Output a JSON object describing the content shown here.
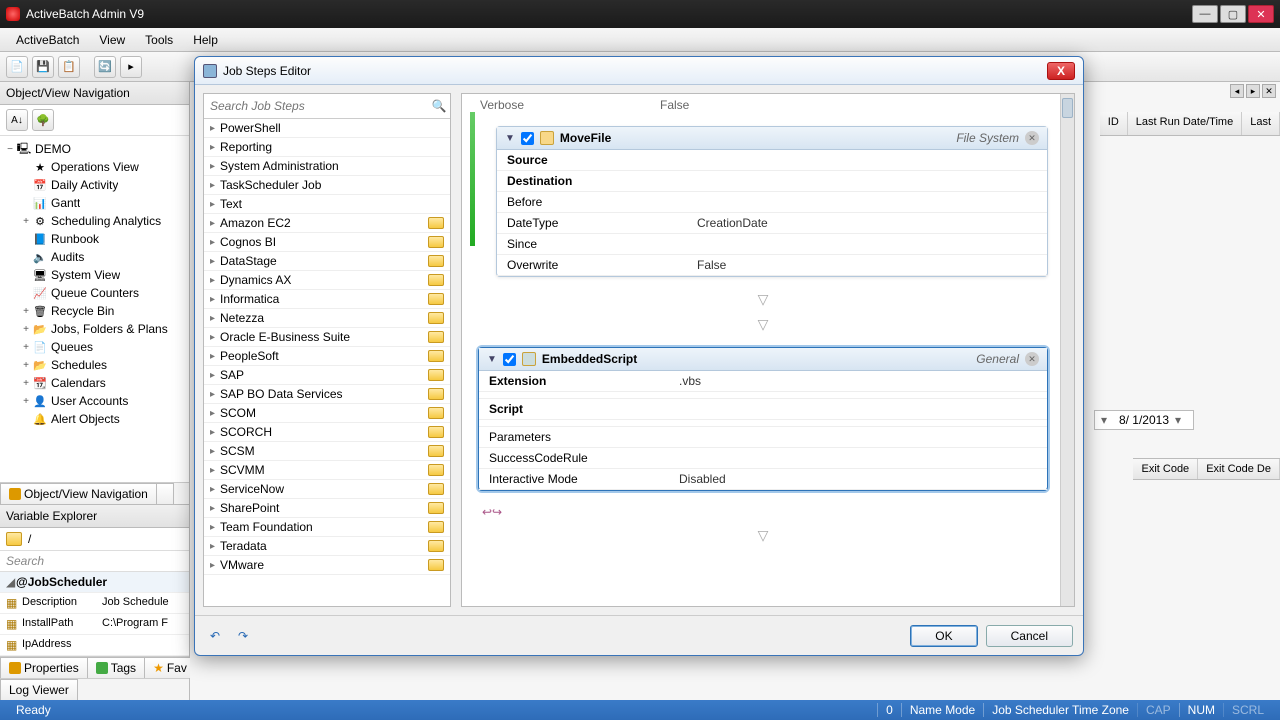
{
  "window": {
    "title": "ActiveBatch Admin V9"
  },
  "menubar": [
    "ActiveBatch",
    "View",
    "Tools",
    "Help"
  ],
  "nav_header": "Object/View Navigation",
  "tree": {
    "root": "DEMO",
    "items": [
      {
        "label": "Operations View",
        "ico": "★"
      },
      {
        "label": "Daily Activity",
        "ico": "📅"
      },
      {
        "label": "Gantt",
        "ico": "📊"
      },
      {
        "label": "Scheduling Analytics",
        "ico": "⚙",
        "exp": "+"
      },
      {
        "label": "Runbook",
        "ico": "📘"
      },
      {
        "label": "Audits",
        "ico": "🔈"
      },
      {
        "label": "System View",
        "ico": "🖥"
      },
      {
        "label": "Queue Counters",
        "ico": "📈"
      },
      {
        "label": "Recycle Bin",
        "ico": "🗑",
        "exp": "+"
      },
      {
        "label": "Jobs, Folders & Plans",
        "ico": "📂",
        "exp": "+"
      },
      {
        "label": "Queues",
        "ico": "📄",
        "exp": "+"
      },
      {
        "label": "Schedules",
        "ico": "📂",
        "exp": "+"
      },
      {
        "label": "Calendars",
        "ico": "📆",
        "exp": "+"
      },
      {
        "label": "User Accounts",
        "ico": "👤",
        "exp": "+"
      },
      {
        "label": "Alert Objects",
        "ico": "🔔"
      }
    ]
  },
  "left_tabs": [
    {
      "label": "Object/View Navigation",
      "active": true
    }
  ],
  "var_explorer": {
    "title": "Variable Explorer",
    "path": "/",
    "search": "Search",
    "section": "@JobScheduler",
    "rows": [
      {
        "name": "Description",
        "value": "Job Schedule"
      },
      {
        "name": "InstallPath",
        "value": "C:\\Program F"
      },
      {
        "name": "IpAddress",
        "value": ""
      }
    ]
  },
  "bottom_tabs": [
    "Properties",
    "Tags",
    "Fav"
  ],
  "log_tab": "Log Viewer",
  "grid_cols_top": [
    "ID",
    "Last Run Date/Time",
    "Last"
  ],
  "grid_cols_bot": [
    "Exit Code",
    "Exit Code De"
  ],
  "date_value": "8/ 1/2013",
  "statusbar": {
    "ready": "Ready",
    "count": "0",
    "name_mode": "Name Mode",
    "tz": "Job Scheduler Time Zone",
    "caps": "CAP",
    "num": "NUM",
    "scrl": "SCRL"
  },
  "modal": {
    "title": "Job Steps Editor",
    "search_placeholder": "Search Job Steps",
    "steps": [
      {
        "label": "PowerShell"
      },
      {
        "label": "Reporting"
      },
      {
        "label": "System Administration"
      },
      {
        "label": "TaskScheduler Job"
      },
      {
        "label": "Text"
      },
      {
        "label": "Amazon EC2",
        "folder": true
      },
      {
        "label": "Cognos BI",
        "folder": true
      },
      {
        "label": "DataStage",
        "folder": true
      },
      {
        "label": "Dynamics AX",
        "folder": true
      },
      {
        "label": "Informatica",
        "folder": true
      },
      {
        "label": "Netezza",
        "folder": true
      },
      {
        "label": "Oracle E-Business Suite",
        "folder": true
      },
      {
        "label": "PeopleSoft",
        "folder": true
      },
      {
        "label": "SAP",
        "folder": true
      },
      {
        "label": "SAP BO Data Services",
        "folder": true
      },
      {
        "label": "SCOM",
        "folder": true
      },
      {
        "label": "SCORCH",
        "folder": true
      },
      {
        "label": "SCSM",
        "folder": true
      },
      {
        "label": "SCVMM",
        "folder": true
      },
      {
        "label": "ServiceNow",
        "folder": true
      },
      {
        "label": "SharePoint",
        "folder": true
      },
      {
        "label": "Team Foundation",
        "folder": true
      },
      {
        "label": "Teradata",
        "folder": true
      },
      {
        "label": "VMware",
        "folder": true
      }
    ],
    "top_stub": {
      "key": "Verbose",
      "value": "False"
    },
    "movefile": {
      "name": "MoveFile",
      "category": "File System",
      "props": [
        {
          "k": "Source",
          "v": "",
          "bold": true
        },
        {
          "k": "Destination",
          "v": "",
          "bold": true
        },
        {
          "k": "Before",
          "v": ""
        },
        {
          "k": "DateType",
          "v": "CreationDate"
        },
        {
          "k": "Since",
          "v": ""
        },
        {
          "k": "Overwrite",
          "v": "False"
        }
      ]
    },
    "embedded": {
      "name": "EmbeddedScript",
      "category": "General",
      "props": [
        {
          "k": "Extension",
          "v": ".vbs",
          "bold": true
        },
        {
          "k": "",
          "v": ""
        },
        {
          "k": "Script",
          "v": "",
          "bold": true
        },
        {
          "k": "",
          "v": ""
        },
        {
          "k": "Parameters",
          "v": ""
        },
        {
          "k": "SuccessCodeRule",
          "v": ""
        },
        {
          "k": "Interactive Mode",
          "v": "Disabled"
        }
      ]
    },
    "buttons": {
      "ok": "OK",
      "cancel": "Cancel"
    }
  }
}
